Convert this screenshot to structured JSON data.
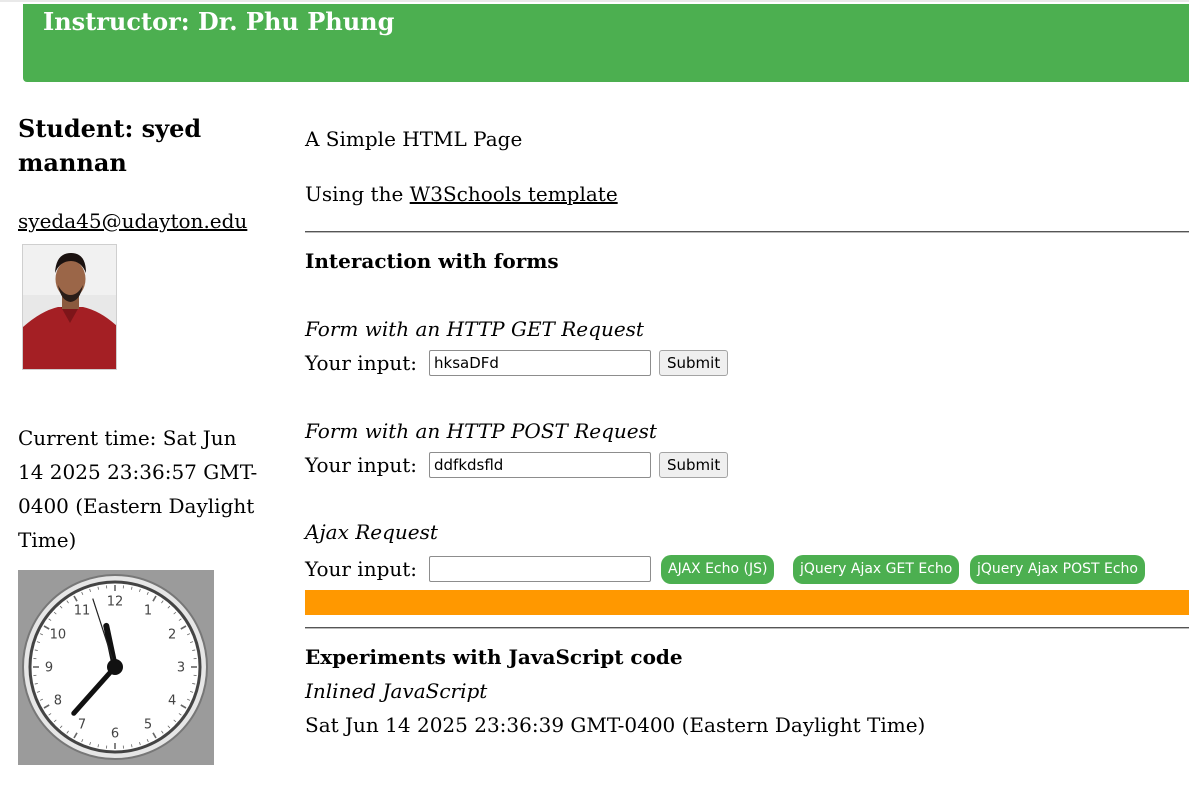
{
  "header": {
    "title": "Instructor: Dr. Phu Phung"
  },
  "sidebar": {
    "student": "Student: syed mannan",
    "email": "syeda45@udayton.edu",
    "current_time": "Current time: Sat Jun 14 2025 23:36:57 GMT-0400 (Eastern Daylight Time)",
    "clock": {
      "hour": 11,
      "minute": 36,
      "second": 57,
      "numbers": [
        "12",
        "1",
        "2",
        "3",
        "4",
        "5",
        "6",
        "7",
        "8",
        "9",
        "10",
        "11"
      ]
    }
  },
  "main": {
    "intro": "A Simple HTML Page",
    "template_prefix": "Using the ",
    "template_link": "W3Schools template",
    "forms_heading": "Interaction with forms",
    "get_form": {
      "title": "Form with an HTTP GET Request",
      "label": "Your input:",
      "value": "hksaDFd",
      "button": "Submit"
    },
    "post_form": {
      "title": "Form with an HTTP POST Request",
      "label": "Your input:",
      "value": "ddfkdsfld",
      "button": "Submit"
    },
    "ajax": {
      "title": "Ajax Request",
      "label": "Your input:",
      "value": "",
      "buttons": [
        "AJAX Echo (JS)",
        "jQuery Ajax GET Echo",
        "jQuery Ajax POST Echo"
      ]
    },
    "js_heading": "Experiments with JavaScript code",
    "inline_js_title": "Inlined JavaScript",
    "inline_js_output": "Sat Jun 14 2025 23:36:39 GMT-0400 (Eastern Daylight Time)"
  },
  "colors": {
    "header_bg": "#4caf50",
    "button_green": "#4caf50",
    "ajax_bar": "#ff9800"
  }
}
